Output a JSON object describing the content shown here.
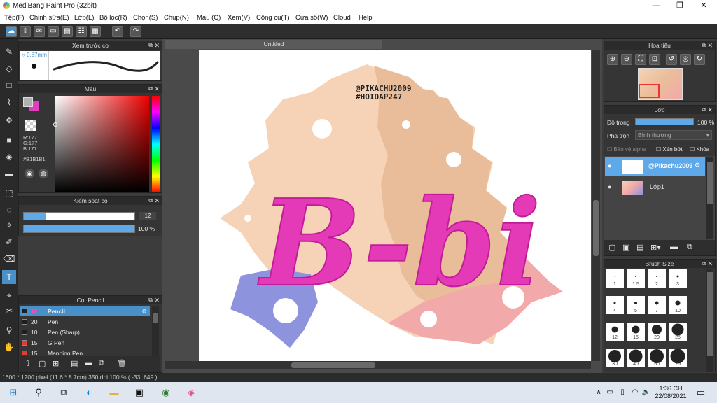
{
  "window": {
    "title": "MediBang Paint Pro (32bit)",
    "min": "—",
    "max": "❐",
    "close": "✕"
  },
  "menu": [
    "Tệp(F)",
    "Chỉnh sửa(E)",
    "Lớp(L)",
    "Bộ lọc(R)",
    "Chọn(S)",
    "Chụp(N)",
    "Màu (C)",
    "Xem(V)",
    "Công cụ(T)",
    "Cửa sổ(W)",
    "Cloud",
    "Help"
  ],
  "preview_panel": {
    "title": "Xem trước cọ",
    "size": "0.87mm"
  },
  "color_panel": {
    "title": "Màu",
    "r": "R:177",
    "g": "G:177",
    "b": "B:177",
    "hex": "#B1B1B1",
    "fg": "#b1b1b1",
    "bg": "#e040c0"
  },
  "brush_control": {
    "title": "Kiểm soát cọ",
    "size": "12",
    "opacity": "100 %",
    "size_fraction": 0.2,
    "opacity_fraction": 1.0
  },
  "brush_panel": {
    "title": "Cọ: Pencil",
    "items": [
      {
        "num": "12",
        "name": "Pencil",
        "color": "#1e1e1e",
        "selected": true
      },
      {
        "num": "20",
        "name": "Pen",
        "color": "#1e1e1e",
        "selected": false
      },
      {
        "num": "10",
        "name": "Pen (Sharp)",
        "color": "#1e1e1e",
        "selected": false
      },
      {
        "num": "15",
        "name": "G Pen",
        "color": "#e53935",
        "selected": false
      },
      {
        "num": "15",
        "name": "Mapping Pen",
        "color": "#e53935",
        "selected": false
      }
    ]
  },
  "document": {
    "tab": "Untitled",
    "watermark1": "@PIKACHU2009",
    "watermark2": "#HOIDAP247",
    "art_text": "B-bi"
  },
  "navigator": {
    "title": "Hoa tiêu"
  },
  "layer_panel": {
    "title": "Lớp",
    "opacity_label": "Độ trong",
    "opacity_value": "100 %",
    "opacity_fraction": 1.0,
    "blend_label": "Pha trộn",
    "blend_value": "Bình thường",
    "protect_alpha": "Bảo vệ alpha",
    "clip": "Xén bớt",
    "lock": "Khóa",
    "layers": [
      {
        "name": "@Pikachu2009",
        "selected": true
      },
      {
        "name": "Lớp1",
        "selected": false
      }
    ]
  },
  "brush_size_panel": {
    "title": "Brush Size",
    "sizes": [
      "1",
      "1.5",
      "2",
      "3",
      "4",
      "5",
      "7",
      "10",
      "12",
      "15",
      "20",
      "25",
      "30",
      "40",
      "50",
      "70"
    ]
  },
  "status": "1600 * 1200 pixel   (11.6 * 8.7cm)   350 dpi   100 %   ( -33, 649 )",
  "taskbar": {
    "time": "1:36 CH",
    "date": "22/08/2021"
  }
}
